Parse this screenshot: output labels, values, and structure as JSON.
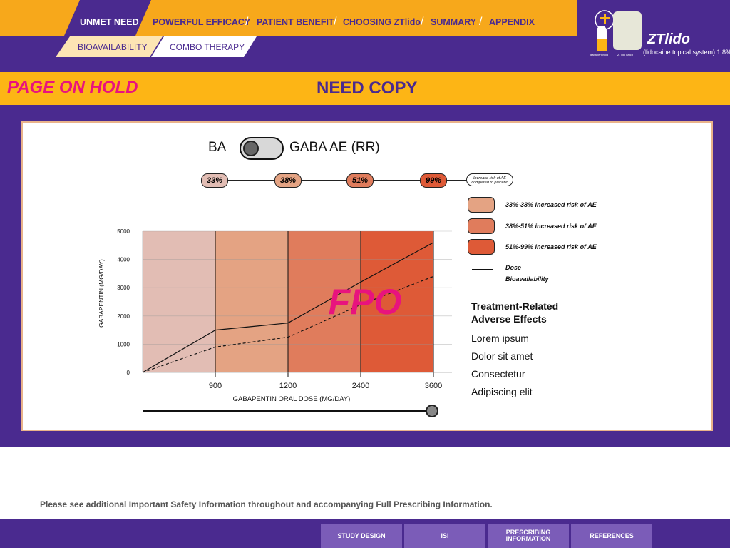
{
  "nav": {
    "tabs": [
      "UNMET NEED",
      "POWERFUL EFFICACY",
      "PATIENT BENEFIT",
      "CHOOSING ZTlido",
      "SUMMARY",
      "APPENDIX"
    ],
    "subtabs": [
      "BIOAVAILABILITY",
      "COMBO THERAPY"
    ]
  },
  "logo": {
    "brand": "ZTlido",
    "tagline": "(lidocaine topical system) 1.8%",
    "caption_left": "gabapentinoid",
    "caption_right": "ZTlido patch"
  },
  "banner": {
    "hold": "PAGE ON HOLD",
    "title": "NEED COPY"
  },
  "toggle": {
    "left_label": "BA",
    "right_label": "GABA AE (RR)"
  },
  "risk_pills": [
    "33%",
    "38%",
    "51%",
    "99%"
  ],
  "risk_pill_legend": "Increase risk of AE compared to placebo",
  "legend": {
    "bands": [
      "33%-38% increased risk of AE",
      "38%-51% increased risk of AE",
      "51%-99% increased risk of AE"
    ],
    "dose": "Dose",
    "bio": "Bioavailability"
  },
  "treatment": {
    "title": "Treatment-Related Adverse Effects",
    "items": [
      "Lorem ipsum",
      "Dolor sit amet",
      "Consectetur",
      "Adipiscing elit"
    ]
  },
  "watermark": "FPO",
  "chart_data": {
    "type": "line",
    "xlabel": "GABAPENTIN ORAL DOSE (MG/DAY)",
    "ylabel": "GABAPENTIN (MG/DAY)",
    "x_ticks": [
      "900",
      "1200",
      "2400",
      "3600"
    ],
    "y_ticks": [
      "0",
      "1000",
      "2000",
      "3000",
      "4000",
      "5000"
    ],
    "ylim": [
      0,
      5000
    ],
    "grid": true,
    "series": [
      {
        "name": "Dose",
        "style": "solid",
        "values": [
          0,
          1500,
          1750,
          3200,
          4600
        ]
      },
      {
        "name": "Bioavailability",
        "style": "dashed",
        "values": [
          0,
          900,
          1250,
          2400,
          3400
        ]
      }
    ],
    "band_colors": [
      "#e2bdb4",
      "#e4a383",
      "#e07c5c",
      "#de5a37"
    ]
  },
  "isi_text": "Please see additional Important Safety Information throughout and accompanying Full Prescribing Information.",
  "footer": [
    "STUDY DESIGN",
    "ISI",
    "PRESCRIBING INFORMATION",
    "REFERENCES"
  ],
  "colors": {
    "purple": "#4a2a8f",
    "orange": "#f7a81b",
    "magenta": "#e8137e"
  }
}
